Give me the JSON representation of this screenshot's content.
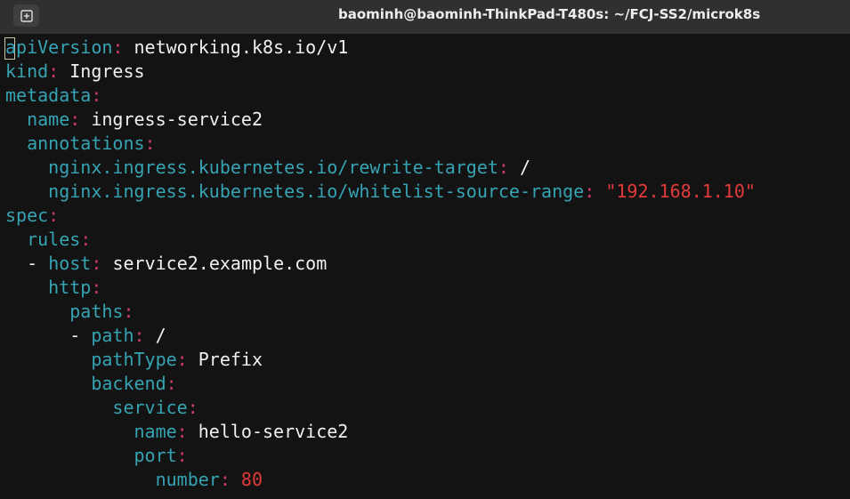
{
  "window": {
    "title": "baominh@baominh-ThinkPad-T480s: ~/FCJ-SS2/microk8s",
    "new_tab_icon": "new-tab-icon"
  },
  "terminal": {
    "lines": [
      {
        "indent": "",
        "dash": "",
        "key": "apiVersion",
        "colon": ":",
        "value": " networking.k8s.io/v1",
        "value_class": "val"
      },
      {
        "indent": "",
        "dash": "",
        "key": "kind",
        "colon": ":",
        "value": " Ingress",
        "value_class": "val"
      },
      {
        "indent": "",
        "dash": "",
        "key": "metadata",
        "colon": ":",
        "value": "",
        "value_class": "val"
      },
      {
        "indent": "  ",
        "dash": "",
        "key": "name",
        "colon": ":",
        "value": " ingress-service2",
        "value_class": "val"
      },
      {
        "indent": "  ",
        "dash": "",
        "key": "annotations",
        "colon": ":",
        "value": "",
        "value_class": "val"
      },
      {
        "indent": "    ",
        "dash": "",
        "key": "nginx.ingress.kubernetes.io/rewrite-target",
        "colon": ":",
        "value": " /",
        "value_class": "val"
      },
      {
        "indent": "    ",
        "dash": "",
        "key": "nginx.ingress.kubernetes.io/whitelist-source-range",
        "colon": ":",
        "value": " \"192.168.1.10\"",
        "value_class": "str"
      },
      {
        "indent": "",
        "dash": "",
        "key": "spec",
        "colon": ":",
        "value": "",
        "value_class": "val"
      },
      {
        "indent": "  ",
        "dash": "",
        "key": "rules",
        "colon": ":",
        "value": "",
        "value_class": "val"
      },
      {
        "indent": "  ",
        "dash": "- ",
        "key": "host",
        "colon": ":",
        "value": " service2.example.com",
        "value_class": "val"
      },
      {
        "indent": "    ",
        "dash": "",
        "key": "http",
        "colon": ":",
        "value": "",
        "value_class": "val"
      },
      {
        "indent": "      ",
        "dash": "",
        "key": "paths",
        "colon": ":",
        "value": "",
        "value_class": "val"
      },
      {
        "indent": "      ",
        "dash": "- ",
        "key": "path",
        "colon": ":",
        "value": " /",
        "value_class": "val"
      },
      {
        "indent": "        ",
        "dash": "",
        "key": "pathType",
        "colon": ":",
        "value": " Prefix",
        "value_class": "val"
      },
      {
        "indent": "        ",
        "dash": "",
        "key": "backend",
        "colon": ":",
        "value": "",
        "value_class": "val"
      },
      {
        "indent": "          ",
        "dash": "",
        "key": "service",
        "colon": ":",
        "value": "",
        "value_class": "val"
      },
      {
        "indent": "            ",
        "dash": "",
        "key": "name",
        "colon": ":",
        "value": " hello-service2",
        "value_class": "val"
      },
      {
        "indent": "            ",
        "dash": "",
        "key": "port",
        "colon": ":",
        "value": "",
        "value_class": "val"
      },
      {
        "indent": "              ",
        "dash": "",
        "key": "number",
        "colon": ":",
        "value": " 80",
        "value_class": "num"
      }
    ]
  },
  "colors": {
    "background": "#131313",
    "titlebar": "#303030",
    "key": "#36a3b3",
    "punctuation": "#cc3a72",
    "string": "#e23a3a",
    "text": "#f0f0f0"
  }
}
